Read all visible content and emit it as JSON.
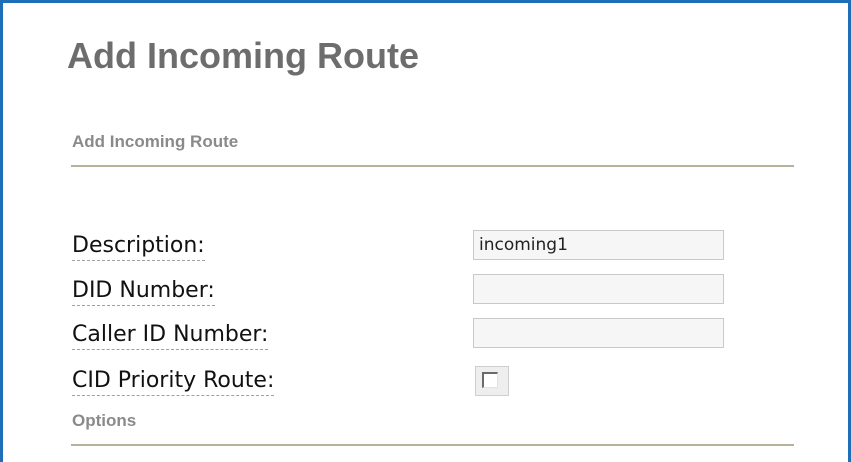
{
  "page": {
    "title": "Add Incoming Route"
  },
  "sections": {
    "main": "Add Incoming Route",
    "options": "Options"
  },
  "fields": {
    "description": {
      "label": "Description:",
      "value": "incoming1"
    },
    "did_number": {
      "label": "DID Number:",
      "value": ""
    },
    "caller_id_number": {
      "label": "Caller ID Number:",
      "value": ""
    },
    "cid_priority_route": {
      "label": "CID Priority Route:",
      "checked": false
    }
  },
  "colors": {
    "frame_border": "#1e6fb7",
    "title_text": "#6d6d6d",
    "section_text": "#8a8a8a",
    "rule": "#b7b29a"
  }
}
